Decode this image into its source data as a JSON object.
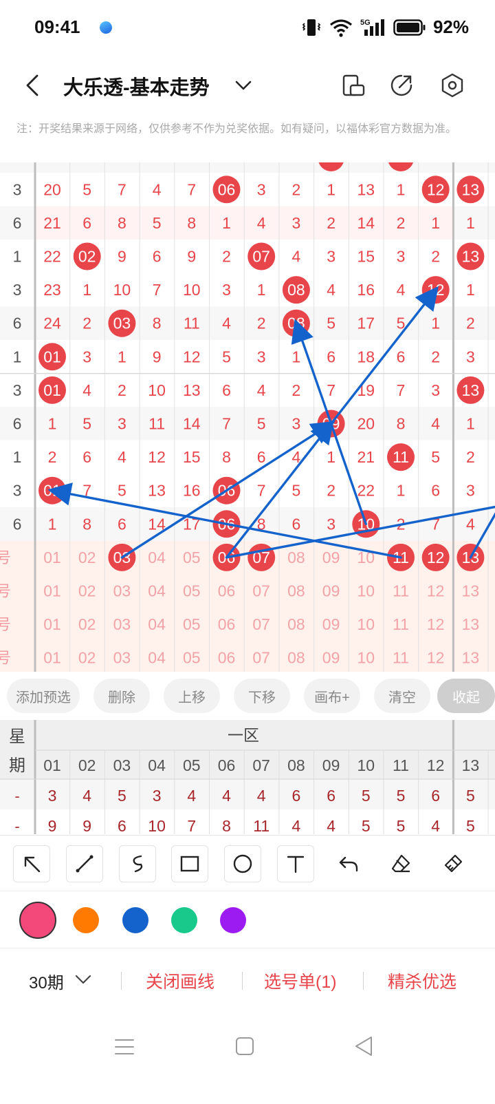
{
  "status_bar": {
    "time": "09:41",
    "battery": "92%"
  },
  "header": {
    "title": "大乐透-基本走势"
  },
  "notice": "注：开奖结果来源于网络，仅供参考不作为兑奖依据。如有疑问，以福体彩官方数据为准。",
  "grid": {
    "rows": [
      [
        "3",
        "20",
        "5",
        "7",
        "4",
        "7",
        "06",
        "3",
        "2",
        "1",
        "13",
        "1",
        "12",
        "13"
      ],
      [
        "6",
        "21",
        "6",
        "8",
        "5",
        "8",
        "1",
        "4",
        "3",
        "2",
        "14",
        "2",
        "1",
        "1"
      ],
      [
        "1",
        "22",
        "02",
        "9",
        "6",
        "9",
        "2",
        "07",
        "4",
        "3",
        "15",
        "3",
        "2",
        "13"
      ],
      [
        "3",
        "23",
        "1",
        "10",
        "7",
        "10",
        "3",
        "1",
        "08",
        "4",
        "16",
        "4",
        "12",
        "1"
      ],
      [
        "6",
        "24",
        "2",
        "03",
        "8",
        "11",
        "4",
        "2",
        "08",
        "5",
        "17",
        "5",
        "1",
        "2"
      ],
      [
        "1",
        "01",
        "3",
        "1",
        "9",
        "12",
        "5",
        "3",
        "1",
        "6",
        "18",
        "6",
        "2",
        "3"
      ],
      [
        "3",
        "01",
        "4",
        "2",
        "10",
        "13",
        "6",
        "4",
        "2",
        "7",
        "19",
        "7",
        "3",
        "13"
      ],
      [
        "6",
        "1",
        "5",
        "3",
        "11",
        "14",
        "7",
        "5",
        "3",
        "09",
        "20",
        "8",
        "4",
        "1"
      ],
      [
        "1",
        "2",
        "6",
        "4",
        "12",
        "15",
        "8",
        "6",
        "4",
        "1",
        "21",
        "11",
        "5",
        "2"
      ],
      [
        "3",
        "01",
        "7",
        "5",
        "13",
        "16",
        "06",
        "7",
        "5",
        "2",
        "22",
        "1",
        "6",
        "3"
      ],
      [
        "6",
        "1",
        "8",
        "6",
        "14",
        "17",
        "06",
        "8",
        "6",
        "3",
        "10",
        "2",
        "7",
        "4"
      ]
    ],
    "hits": [
      [
        0,
        6
      ],
      [
        0,
        12
      ],
      [
        0,
        13
      ],
      [
        2,
        2
      ],
      [
        2,
        7
      ],
      [
        2,
        13
      ],
      [
        3,
        8
      ],
      [
        3,
        12
      ],
      [
        4,
        3
      ],
      [
        4,
        8
      ],
      [
        5,
        1
      ],
      [
        6,
        1
      ],
      [
        6,
        13
      ],
      [
        7,
        9
      ],
      [
        8,
        11
      ],
      [
        9,
        1
      ],
      [
        9,
        6
      ],
      [
        10,
        6
      ],
      [
        10,
        10
      ]
    ],
    "pick_rows": [
      {
        "label": "号",
        "numbers": [
          "01",
          "02",
          "03",
          "04",
          "05",
          "06",
          "07",
          "08",
          "09",
          "10",
          "11",
          "12",
          "13"
        ]
      },
      {
        "label": "号",
        "numbers": [
          "01",
          "02",
          "03",
          "04",
          "05",
          "06",
          "07",
          "08",
          "09",
          "10",
          "11",
          "12",
          "13"
        ]
      },
      {
        "label": "号",
        "numbers": [
          "01",
          "02",
          "03",
          "04",
          "05",
          "06",
          "07",
          "08",
          "09",
          "10",
          "11",
          "12",
          "13"
        ]
      },
      {
        "label": "号",
        "numbers": [
          "01",
          "02",
          "03",
          "04",
          "05",
          "06",
          "07",
          "08",
          "09",
          "10",
          "11",
          "12",
          "13"
        ]
      }
    ],
    "pick_hits": [
      3,
      6,
      7,
      11,
      12,
      13
    ]
  },
  "actions": [
    "添加预选",
    "删除",
    "上移",
    "下移",
    "画布+",
    "清空",
    "收起"
  ],
  "table2": {
    "corner": [
      "星",
      "期"
    ],
    "zone": "一区",
    "columns": [
      "01",
      "02",
      "03",
      "04",
      "05",
      "06",
      "07",
      "08",
      "09",
      "10",
      "11",
      "12",
      "13"
    ],
    "rows": [
      {
        "label": "-",
        "values": [
          "3",
          "4",
          "5",
          "3",
          "4",
          "4",
          "4",
          "6",
          "6",
          "5",
          "5",
          "6",
          "5"
        ]
      },
      {
        "label": "-",
        "values": [
          "9",
          "9",
          "6",
          "10",
          "7",
          "8",
          "11",
          "4",
          "4",
          "5",
          "5",
          "4",
          "5"
        ]
      }
    ]
  },
  "tools": [
    "arrow-tool",
    "line-tool",
    "freehand-tool",
    "rectangle-tool",
    "circle-tool",
    "text-tool",
    "undo-tool",
    "eraser-tool",
    "clear-brush-tool"
  ],
  "colors": [
    "#f2487a",
    "#ff7a00",
    "#1463cc",
    "#19c98c",
    "#9b1bf0"
  ],
  "selected_color": "#f2487a",
  "bottom_bar": {
    "period": "30期",
    "close_lines": "关闭画线",
    "ticket": "选号单(1)",
    "optimize": "精杀优选"
  },
  "accent_color": "#e8454b",
  "arrow_color": "#1463cc"
}
